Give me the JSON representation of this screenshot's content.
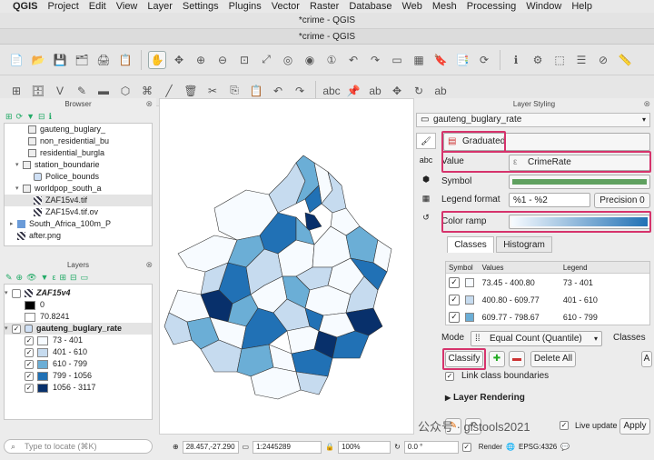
{
  "menubar": {
    "app": "QGIS",
    "items": [
      "Project",
      "Edit",
      "View",
      "Layer",
      "Settings",
      "Plugins",
      "Vector",
      "Raster",
      "Database",
      "Web",
      "Mesh",
      "Processing",
      "Window",
      "Help"
    ]
  },
  "window_title": "*crime - QGIS",
  "project_title": "*crime - QGIS",
  "browser": {
    "title": "Browser",
    "items": [
      {
        "label": "gauteng_buglary_",
        "type": "table",
        "indent": 3
      },
      {
        "label": "non_residential_bu",
        "type": "table",
        "indent": 3
      },
      {
        "label": "residential_burgla",
        "type": "table",
        "indent": 3
      },
      {
        "label": "station_boundarie",
        "type": "table",
        "indent": 2,
        "arrow": "▾"
      },
      {
        "label": "Police_bounds",
        "type": "poly",
        "indent": 4
      },
      {
        "label": "worldpop_south_a",
        "type": "table",
        "indent": 2,
        "arrow": "▾"
      },
      {
        "label": "ZAF15v4.tif",
        "type": "raster",
        "indent": 4,
        "selected": true
      },
      {
        "label": "ZAF15v4.tif.ov",
        "type": "raster",
        "indent": 4
      },
      {
        "label": "South_Africa_100m_P",
        "type": "folder",
        "indent": 1,
        "arrow": "▸"
      },
      {
        "label": "after.png",
        "type": "raster",
        "indent": 1
      }
    ]
  },
  "layers": {
    "title": "Layers",
    "raster_layer": {
      "name": "ZAF15v4",
      "checked": false,
      "min": "0",
      "max": "70.8241"
    },
    "vector_layer": {
      "name": "gauteng_buglary_rate",
      "checked": true,
      "classes": [
        {
          "label": "73 - 401",
          "color": "#f7fbff"
        },
        {
          "label": "401 - 610",
          "color": "#c6dbef"
        },
        {
          "label": "610 - 799",
          "color": "#6baed6"
        },
        {
          "label": "799 - 1056",
          "color": "#2171b5"
        },
        {
          "label": "1056 - 3117",
          "color": "#08306b"
        }
      ]
    }
  },
  "search": {
    "placeholder": "Type to locate (⌘K)"
  },
  "status": {
    "coordinate": "28.457,-27.290",
    "scale": "1:2445289",
    "magnifier": "100%",
    "rotation": "0.0 °",
    "render_label": "Render",
    "crs": "EPSG:4326"
  },
  "styling": {
    "title": "Layer Styling",
    "layer": "gauteng_buglary_rate",
    "renderer": "Graduated",
    "value_label": "Value",
    "value": "CrimeRate",
    "symbol_label": "Symbol",
    "legend_format_label": "Legend format",
    "legend_format": "%1 - %2",
    "precision_label": "Precision 0",
    "color_ramp_label": "Color ramp",
    "tabs": [
      "Classes",
      "Histogram"
    ],
    "table_headers": [
      "Symbol",
      "Values",
      "Legend"
    ],
    "table_rows": [
      {
        "values": "73.45 - 400.80",
        "legend": "73 - 401",
        "color": "#f7fbff"
      },
      {
        "values": "400.80 - 609.77",
        "legend": "401 - 610",
        "color": "#c6dbef"
      },
      {
        "values": "609.77 - 798.67",
        "legend": "610 - 799",
        "color": "#6baed6"
      }
    ],
    "mode_label": "Mode",
    "mode": "Equal Count (Quantile)",
    "classes_label": "Classes",
    "classify_label": "Classify",
    "delete_all_label": "Delete All",
    "link_boundaries_label": "Link class boundaries",
    "layer_rendering_label": "Layer Rendering",
    "live_update_label": "Live update",
    "apply_label": "Apply",
    "watermark": "公众号 · gistools2021"
  },
  "colors": {
    "highlight": "#d6336c",
    "ramp_start": "#f7fbff",
    "ramp_end": "#2171b5",
    "symbol_green": "#5fa05f"
  }
}
